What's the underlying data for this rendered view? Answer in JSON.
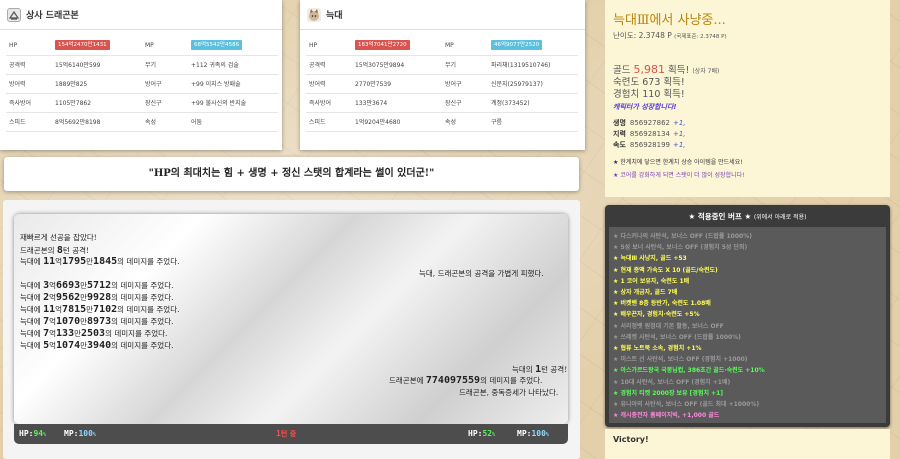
{
  "enemy_card": {
    "title": "상사 드래곤본",
    "icon": "leaf-icon",
    "rows": [
      {
        "l1": "HP",
        "v1": "154억2470만1431",
        "l2": "MP",
        "v2": "68억5542만4586"
      },
      {
        "l1": "공격력",
        "v1": "15억6140만599",
        "l2": "무기",
        "v2": "+112 귀족의 검술"
      },
      {
        "l1": "방어력",
        "v1": "1889만825",
        "l2": "방어구",
        "v2": "+99 이지스 방패술"
      },
      {
        "l1": "즉사방어",
        "v1": "1105만7862",
        "l2": "장신구",
        "v2": "+99 불사신의 반지술"
      },
      {
        "l1": "스피드",
        "v1": "8억5692만8198",
        "l2": "속성",
        "v2": "어둠"
      }
    ]
  },
  "player_card": {
    "title": "늑대",
    "icon": "wolf-avatar-icon",
    "rows": [
      {
        "l1": "HP",
        "v1": "183억7041만2720",
        "l2": "MP",
        "v2": "46억9077만2520"
      },
      {
        "l1": "공격력",
        "v1": "15억3075만9894",
        "l2": "무기",
        "v2": "파리채(1319510746)"
      },
      {
        "l1": "방어력",
        "v1": "2770만7539",
        "l2": "방어구",
        "v2": "신문지(25979137)"
      },
      {
        "l1": "즉사방어",
        "v1": "133만3674",
        "l2": "장신구",
        "v2": "계정(373452)"
      },
      {
        "l1": "스피드",
        "v1": "1억9204만4680",
        "l2": "속성",
        "v2": "구름"
      }
    ]
  },
  "quote": "\"HP의 최대치는 힘 + 생명 + 정신 스탯의 합계라는 썰이 있더군!\"",
  "battle": {
    "lines": [
      {
        "text": "재빠르게 선공을 잡았다!"
      },
      {
        "pre": "드래곤본의 ",
        "a": "8",
        "mid": "턴 공격!",
        "b": "",
        "post": ""
      },
      {
        "pre": "늑대에 ",
        "a": "11",
        "mid": "억",
        "b": "1795",
        "mid2": "만",
        "c": "1845",
        "post": "의 데미지를 주었다."
      },
      {
        "text": "늑대, 드래곤본의 공격을 가볍게 피했다."
      },
      {
        "pre": "늑대에 ",
        "a": "3",
        "mid": "억",
        "b": "6693",
        "mid2": "만",
        "c": "5712",
        "post": "의 데미지를 주었다."
      },
      {
        "pre": "늑대에 ",
        "a": "2",
        "mid": "억",
        "b": "9562",
        "mid2": "만",
        "c": "9928",
        "post": "의 데미지를 주었다."
      },
      {
        "pre": "늑대에 ",
        "a": "11",
        "mid": "억",
        "b": "7815",
        "mid2": "만",
        "c": "7102",
        "post": "의 데미지를 주었다."
      },
      {
        "pre": "늑대에 ",
        "a": "7",
        "mid": "억",
        "b": "1070",
        "mid2": "만",
        "c": "8973",
        "post": "의 데미지를 주었다."
      },
      {
        "pre": "늑대에 ",
        "a": "7",
        "mid": "억",
        "b": "133",
        "mid2": "만",
        "c": "2503",
        "post": "의 데미지를 주었다."
      },
      {
        "pre": "늑대에 ",
        "a": "5",
        "mid": "억",
        "b": "1074",
        "mid2": "만",
        "c": "3940",
        "post": "의 데미지를 주었다."
      },
      {
        "pre": "늑대의 ",
        "a": "1",
        "mid": "턴 공격!"
      },
      {
        "pre": "드래곤본에 ",
        "a": "774097559",
        "post": "의 데미지를 주었다."
      },
      {
        "text": "드래곤본, 중독증세가 나타났다."
      }
    ],
    "bar": {
      "left_hp_label": "HP:",
      "left_hp": "94",
      "left_mp_label": "MP:",
      "left_mp": "100",
      "turn_num": "1",
      "turn_label": "턴 중",
      "right_hp_label": "HP:",
      "right_hp": "52",
      "right_mp_label": "MP:",
      "right_mp": "100",
      "pct": "%"
    }
  },
  "hunt": {
    "title": "늑대Ⅲ에서 사냥중...",
    "difficulty": "난이도: 2.3748 P",
    "difficulty_note": "(국제표준: 2.3748 P)",
    "gold_pre": "골드 ",
    "gold": "5,981",
    "gold_post": " 획득!",
    "gold_note": "(상자 7배)",
    "skill": "숙련도 673 획득!",
    "exp": "경험치 110 획득!",
    "growth": "캐릭터가 성장합니다!",
    "stats": [
      {
        "name": "생명",
        "value": "856927862",
        "inc": "+1,"
      },
      {
        "name": "지력",
        "value": "856928134",
        "inc": "+1,"
      },
      {
        "name": "속도",
        "value": "856928199",
        "inc": "+1,"
      }
    ],
    "note1": "★ 한계치에 닿으면 한계치 상승 아이템을 만드세요!",
    "note2": "★ 코어를 강화하게 되면 스탯이 더 많이 성장합니다!"
  },
  "buffs": {
    "title": "★ 적용중인 버프 ★",
    "subtitle": "(위에서 아래로 적용)",
    "items": [
      {
        "text": "★ 다스커나의 사탄석, 보너스 OFF (드랍률 1000%)",
        "color": "#9a9a9a"
      },
      {
        "text": "★ 5성 보너 사탄석, 보너스 OFF (경험치 5성 단죄)",
        "color": "#9a9a9a"
      },
      {
        "text": "★ 늑대Ⅲ 사냥지, 골드 +53",
        "color": "#ffff55"
      },
      {
        "text": "★ 현재 증액 가속도 X 10 (골드/숙련도)",
        "color": "#ffff55"
      },
      {
        "text": "★ 1 코어 보유자, 숙련도 1배",
        "color": "#ffff55"
      },
      {
        "text": "★ 상자 개금자, 골드 7배",
        "color": "#ffff55"
      },
      {
        "text": "★ 버켓밴 8층 등반가, 숙련도 1.08배",
        "color": "#ffff55"
      },
      {
        "text": "★ 배우끈자, 경험치·숙련도 +5%",
        "color": "#ffff55"
      },
      {
        "text": "★ 서리정뱃 원정대 기본 활동, 보너스 OFF",
        "color": "#9a9a9a"
      },
      {
        "text": "★ 쓰레켓 사탄석, 보너스 OFF (드랍률 1000%)",
        "color": "#9a9a9a"
      },
      {
        "text": "★ 협류 노트북 소속, 경험치 +1%",
        "color": "#ffff55"
      },
      {
        "text": "★ 미스트 선 사탄석, 보너스 OFF (경험치 +1000)",
        "color": "#9a9a9a"
      },
      {
        "text": "★ 아스가르드왕국 국봉님컵, 386초간 골드·숙련도 +10%",
        "color": "#55ff55"
      },
      {
        "text": "★ 10대 사탄석, 보너스 OFF (경험치 +1배)",
        "color": "#9a9a9a"
      },
      {
        "text": "★ 경험치 티켓 2000장 보유 [경험치 +1]",
        "color": "#55ff55"
      },
      {
        "text": "★ 유니아의 사탄석, 보너스 OFF (골드 최대 +1000%)",
        "color": "#9a9a9a"
      },
      {
        "text": "★ 캐시충전자 홈페이지빅, +1,000 골드",
        "color": "#ff88dd"
      }
    ]
  },
  "victory": "Victory!",
  "colors": {
    "hp_bar": "#d9534f",
    "mp_bar": "#5bc0de",
    "hunt_title": "#b8860b",
    "gold": "#d9534f",
    "growth": "#5b3fd6",
    "stat_inc": "#3a5fcd",
    "buff_panel": "#3b3b3b"
  }
}
